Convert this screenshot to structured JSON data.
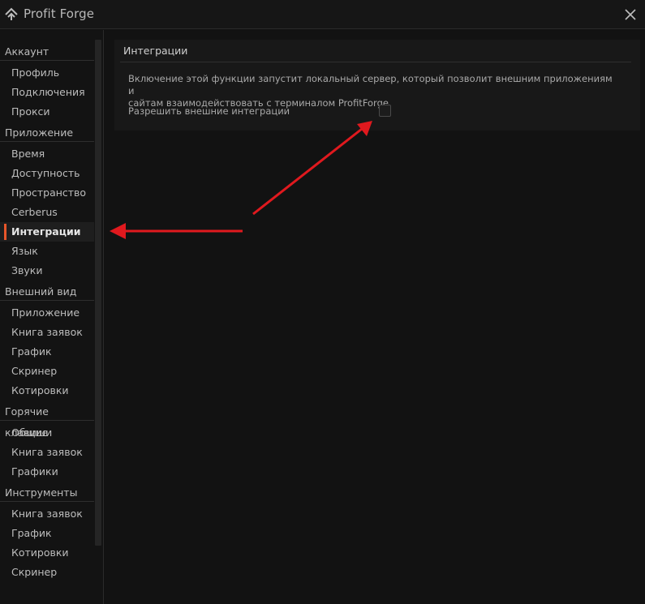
{
  "app": {
    "title": "Profit Forge",
    "close_icon": "close-icon",
    "logo_icon": "profit-forge-logo"
  },
  "sidebar": {
    "sections": [
      {
        "header": "Аккаунт",
        "items": [
          "Профиль",
          "Подключения",
          "Прокси"
        ]
      },
      {
        "header": "Приложение",
        "items": [
          "Время",
          "Доступность",
          "Пространство",
          "Cerberus",
          "Интеграции",
          "Язык",
          "Звуки"
        ]
      },
      {
        "header": "Внешний вид",
        "items": [
          "Приложение",
          "Книга заявок",
          "График",
          "Скринер",
          "Котировки"
        ]
      },
      {
        "header": "Горячие клавиши",
        "items": [
          "Общие",
          "Книга заявок",
          "Графики"
        ]
      },
      {
        "header": "Инструменты",
        "items": [
          "Книга заявок",
          "График",
          "Котировки",
          "Скринер"
        ]
      }
    ],
    "active_item": "Интеграции",
    "accent_color": "#e8562a"
  },
  "integrations": {
    "title": "Интеграции",
    "description_line1": "Включение этой функции запустит локальный сервер, который позволит внешним приложениям и",
    "description_line2": "сайтам взаимодействовать с терминалом ProfitForge.",
    "checkbox_label": "Разрешить внешние интеграции",
    "checkbox_checked": false
  },
  "annotations": {
    "arrow_color": "#e0191e"
  }
}
